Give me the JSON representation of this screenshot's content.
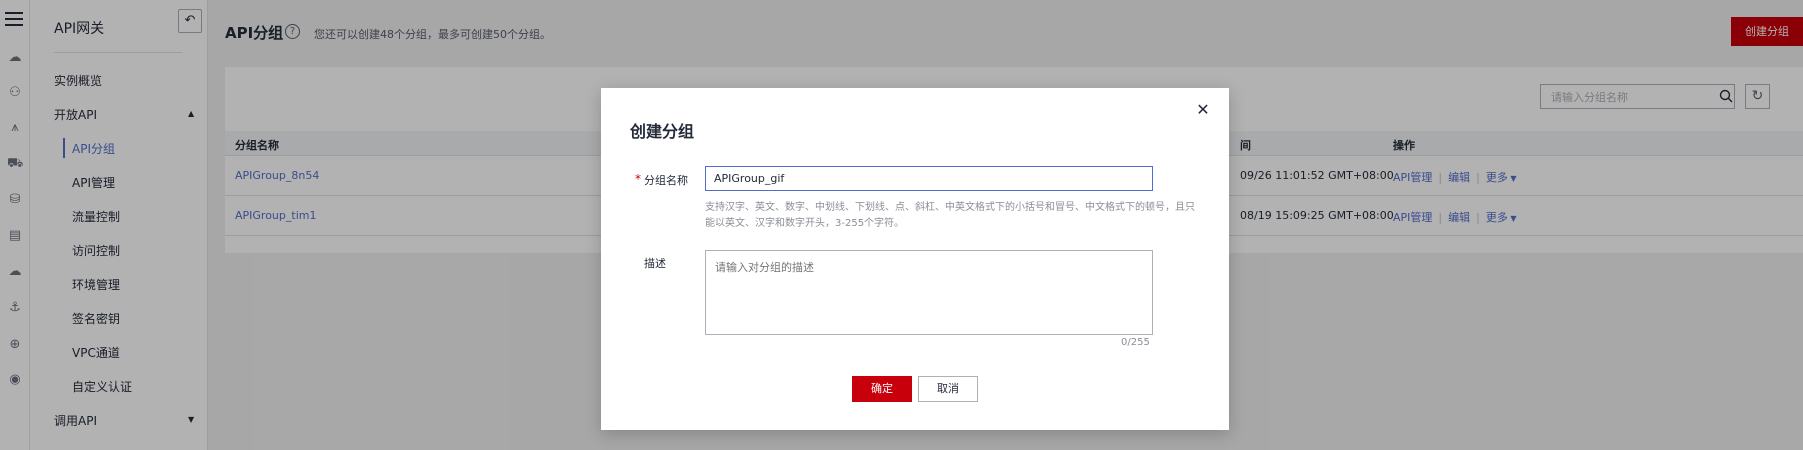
{
  "rail": {
    "icons": [
      "cloud-icon",
      "cluster-icon",
      "bridge-icon",
      "car-icon",
      "database-icon",
      "document-icon",
      "cloud-upload-icon",
      "ship-icon",
      "globe-icon",
      "shield-icon"
    ]
  },
  "sidebar": {
    "title": "API网关",
    "overview": "实例概览",
    "open_api": "开放API",
    "items": [
      "API分组",
      "API管理",
      "流量控制",
      "访问控制",
      "环境管理",
      "签名密钥",
      "VPC通道",
      "自定义认证"
    ],
    "active_index": 0,
    "call_api": "调用API"
  },
  "header": {
    "title": "API分组",
    "quota": "您还可以创建48个分组，最多可创建50个分组。",
    "create_button": "创建分组"
  },
  "list": {
    "search_placeholder": "请输入分组名称",
    "columns": {
      "name": "分组名称",
      "time": "间",
      "ops": "操作"
    },
    "rows": [
      {
        "name": "APIGroup_8n54",
        "time": "09/26 11:01:52 GMT+08:00"
      },
      {
        "name": "APIGroup_tim1",
        "time": "08/19 15:09:25 GMT+08:00"
      }
    ],
    "op_manage": "API管理",
    "op_edit": "编辑",
    "op_more": "更多"
  },
  "dialog": {
    "title": "创建分组",
    "name_label": "分组名称",
    "name_value": "APIGroup_gif",
    "hint": "支持汉字、英文、数字、中划线、下划线、点、斜杠、中英文格式下的小括号和冒号、中文格式下的顿号，且只能以英文、汉字和数字开头，3-255个字符。",
    "desc_label": "描述",
    "desc_placeholder": "请输入对分组的描述",
    "counter": "0/255",
    "ok": "确定",
    "cancel": "取消"
  }
}
